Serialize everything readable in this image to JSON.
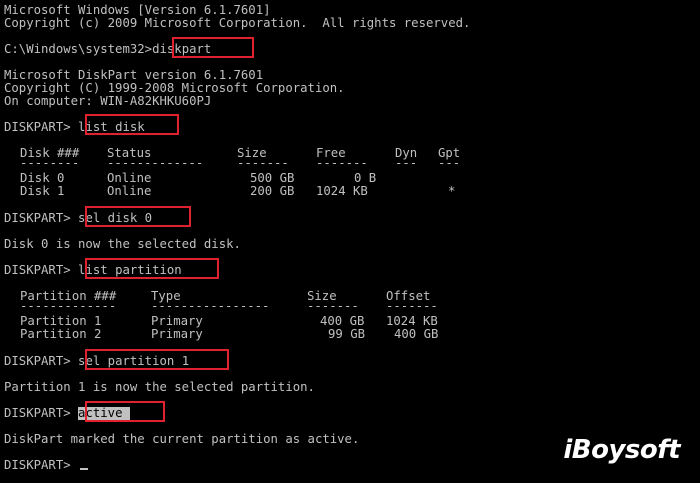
{
  "header": {
    "line1": "Microsoft Windows [Version 6.1.7601]",
    "line2": "Copyright (c) 2009 Microsoft Corporation.  All rights reserved."
  },
  "prompt1": {
    "path": "C:\\Windows\\system32>",
    "command": "diskpart"
  },
  "diskpart_info": {
    "line1": "Microsoft DiskPart version 6.1.7601",
    "line2": "Copyright (C) 1999-2008 Microsoft Corporation.",
    "line3": "On computer: WIN-A82KHKU60PJ"
  },
  "prompt_label": "DISKPART> ",
  "commands": {
    "list_disk": "list disk",
    "sel_disk": "sel disk 0",
    "list_partition": "list partition",
    "sel_partition": "sel partition 1",
    "active": "active"
  },
  "disk_table": {
    "headers": [
      "Disk ###",
      "Status",
      "Size",
      "Free",
      "Dyn",
      "Gpt"
    ],
    "separators": [
      "--------",
      "-------------",
      "-------",
      "-------",
      "---",
      "---"
    ],
    "rows": [
      [
        "Disk 0",
        "Online",
        "500 GB",
        "0 B",
        "",
        ""
      ],
      [
        "Disk 1",
        "Online",
        "200 GB",
        "1024 KB",
        "",
        "*"
      ]
    ]
  },
  "messages": {
    "disk_selected": "Disk 0 is now the selected disk.",
    "partition_selected": "Partition 1 is now the selected partition.",
    "marked_active": "DiskPart marked the current partition as active."
  },
  "partition_table": {
    "headers": [
      "Partition ###",
      "Type",
      "Size",
      "Offset"
    ],
    "separators": [
      "-------------",
      "----------------",
      "-------",
      "-------"
    ],
    "rows": [
      [
        "Partition 1",
        "Primary",
        "400 GB",
        "1024 KB"
      ],
      [
        "Partition 2",
        "Primary",
        "99 GB",
        "400 GB"
      ]
    ]
  },
  "watermark": "iBoysoft",
  "colors": {
    "background": "#000000",
    "text": "#c0c0c0",
    "highlight_border": "#e0222e"
  }
}
